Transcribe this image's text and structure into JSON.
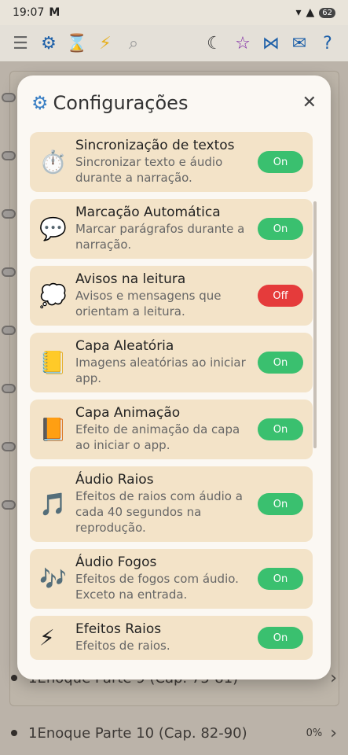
{
  "status": {
    "time": "19:07",
    "gmail": "M",
    "battery": "62"
  },
  "toolbar": {
    "icons": [
      "menu-icon",
      "gear-icon",
      "hourglass-icon",
      "lightning-icon",
      "search-icon",
      "moon-icon",
      "star-icon",
      "share-icon",
      "mail-icon",
      "help-icon"
    ]
  },
  "background_list": [
    {
      "label": "1Enoque Parte 9 (Cap. 75-81)"
    },
    {
      "label": "1Enoque Parte 10 (Cap. 82-90)",
      "progress": "0%"
    }
  ],
  "modal": {
    "title": "Configurações",
    "items": [
      {
        "title": "Sincronização de textos",
        "desc": "Sincronizar texto e áudio durante a narração.",
        "state": "On",
        "icon": "⏱️"
      },
      {
        "title": "Marcação Automática",
        "desc": "Marcar parágrafos durante a narração.",
        "state": "On",
        "icon": "💬"
      },
      {
        "title": "Avisos na leitura",
        "desc": "Avisos e mensagens que orientam a leitura.",
        "state": "Off",
        "icon": "💭"
      },
      {
        "title": "Capa Aleatória",
        "desc": "Imagens aleatórias ao iniciar app.",
        "state": "On",
        "icon": "📒"
      },
      {
        "title": "Capa Animação",
        "desc": "Efeito de animação da capa ao iniciar o app.",
        "state": "On",
        "icon": "📙"
      },
      {
        "title": "Áudio Raios",
        "desc": "Efeitos de raios com áudio a cada 40 segundos na reprodução.",
        "state": "On",
        "icon": "🎵"
      },
      {
        "title": "Áudio Fogos",
        "desc": "Efeitos de fogos com áudio. Exceto na entrada.",
        "state": "On",
        "icon": "🎶"
      },
      {
        "title": "Efeitos Raios",
        "desc": "Efeitos de raios.",
        "state": "On",
        "icon": "⚡"
      }
    ]
  }
}
